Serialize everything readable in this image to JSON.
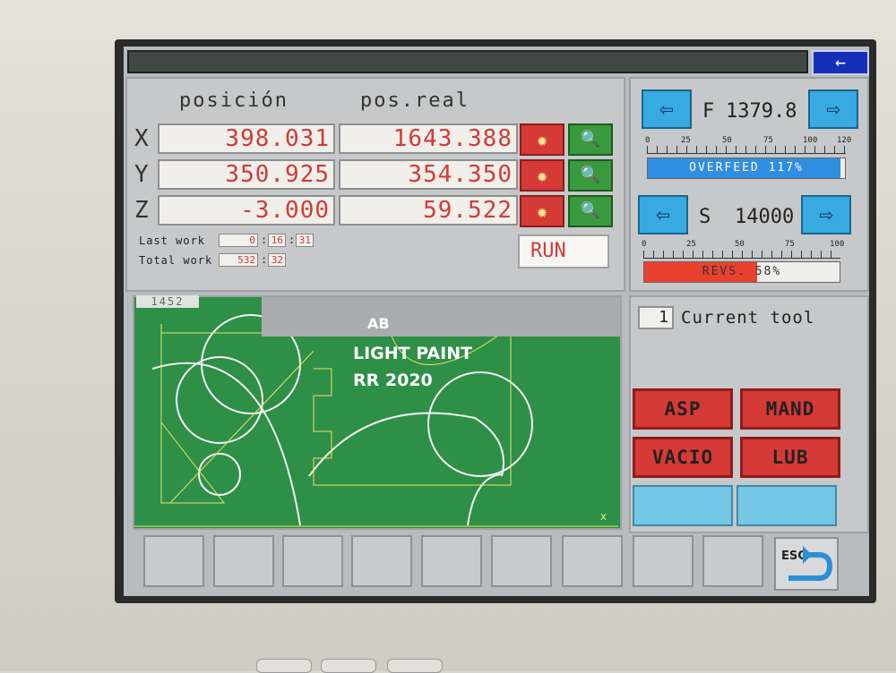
{
  "header": {
    "back_icon": "←"
  },
  "position": {
    "col_position": "posición",
    "col_real": "pos.real",
    "axes": [
      {
        "axis": "X",
        "position": "398.031",
        "real": "1643.388"
      },
      {
        "axis": "Y",
        "position": "350.925",
        "real": "354.350"
      },
      {
        "axis": "Z",
        "position": "-3.000",
        "real": "59.522"
      }
    ],
    "last_work_label": "Last work",
    "last_work": [
      "0",
      "16",
      "31"
    ],
    "total_work_label": "Total work",
    "total_work": [
      "532",
      "32"
    ],
    "status": "RUN"
  },
  "feed": {
    "letter": "F",
    "value": "1379.8",
    "scale": [
      "0",
      "25",
      "50",
      "75",
      "100",
      "120"
    ],
    "bar_label": "OVERFEED 117%",
    "bar_fraction": 0.975,
    "bar_color": "#2f8ee0"
  },
  "spindle": {
    "letter": "S",
    "value": "14000",
    "scale": [
      "0",
      "25",
      "50",
      "75",
      "100"
    ],
    "bar_label": "REVS. 58%",
    "bar_fraction": 0.58,
    "bar_color": "#e8412e"
  },
  "graphic": {
    "number": "1452",
    "x_axis": "x",
    "overlay_line1": "LIGHT PAINT",
    "overlay_line2": "RR 2020",
    "overlay_mark": "AB"
  },
  "tool": {
    "number": "1",
    "label": "Current tool"
  },
  "functions": [
    "ASP",
    "MAND",
    "VACIO",
    "LUB"
  ],
  "esc_label": "ESC",
  "colors": {
    "red_button": "#d53a36",
    "green_button": "#3a9a3e",
    "blue_button": "#39a9e2",
    "canvas": "#2e8f47"
  }
}
